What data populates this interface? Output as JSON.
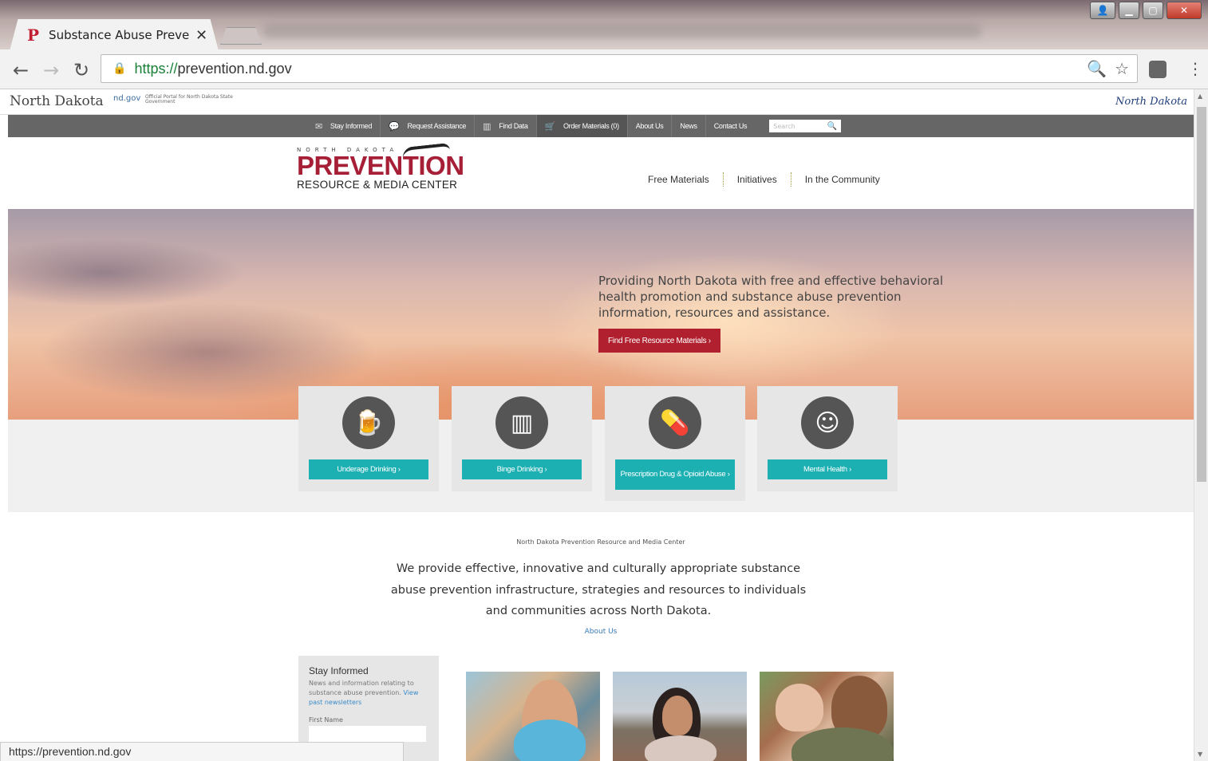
{
  "browser": {
    "tab_title": "Substance Abuse Preven",
    "tab_favicon": "P",
    "url_scheme": "https://",
    "url_host": "prevention.nd.gov",
    "status_url": "https://prevention.nd.gov"
  },
  "ndbar": {
    "state": "North Dakota",
    "ndgov": "nd.gov",
    "portal": "Official Portal for North Dakota State Government",
    "script_logo": "North Dakota"
  },
  "utilnav": {
    "items": [
      {
        "label": "Stay Informed",
        "icon": "envelope-icon"
      },
      {
        "label": "Request Assistance",
        "icon": "chat-icon"
      },
      {
        "label": "Find Data",
        "icon": "chart-icon"
      },
      {
        "label": "Order Materials (0)",
        "icon": "cart-icon"
      },
      {
        "label": "About Us"
      },
      {
        "label": "News"
      },
      {
        "label": "Contact Us"
      }
    ],
    "search_placeholder": "Search"
  },
  "header": {
    "logo_top": "NORTH DAKOTA",
    "logo_main": "PREVENTION",
    "logo_sub": "RESOURCE & MEDIA CENTER",
    "nav": [
      "Free Materials",
      "Initiatives",
      "In the Community"
    ]
  },
  "hero": {
    "text": "Providing North Dakota with free and effective behavioral health promotion and substance abuse prevention information, resources and assistance.",
    "button": "Find Free Resource Materials ›"
  },
  "cards": [
    {
      "label": "Underage Drinking ›",
      "icon": "beer-mug-icon"
    },
    {
      "label": "Binge Drinking ›",
      "icon": "shot-glasses-icon"
    },
    {
      "label": "Prescription Drug & Opioid Abuse ›",
      "icon": "pills-icon"
    },
    {
      "label": "Mental Health ›",
      "icon": "head-icon"
    }
  ],
  "mission": {
    "small": "North Dakota Prevention Resource and Media Center",
    "text": "We provide effective, innovative and culturally appropriate substance abuse prevention infrastructure, strategies and resources to individuals and communities across North Dakota.",
    "link": "About Us"
  },
  "stay": {
    "heading": "Stay Informed",
    "desc": "News and information relating to substance abuse prevention.",
    "link": "View past newsletters",
    "first_name_label": "First Name"
  },
  "colors": {
    "brand_red": "#a61f37",
    "teal": "#1db0b3",
    "utility_gray": "#666666"
  }
}
